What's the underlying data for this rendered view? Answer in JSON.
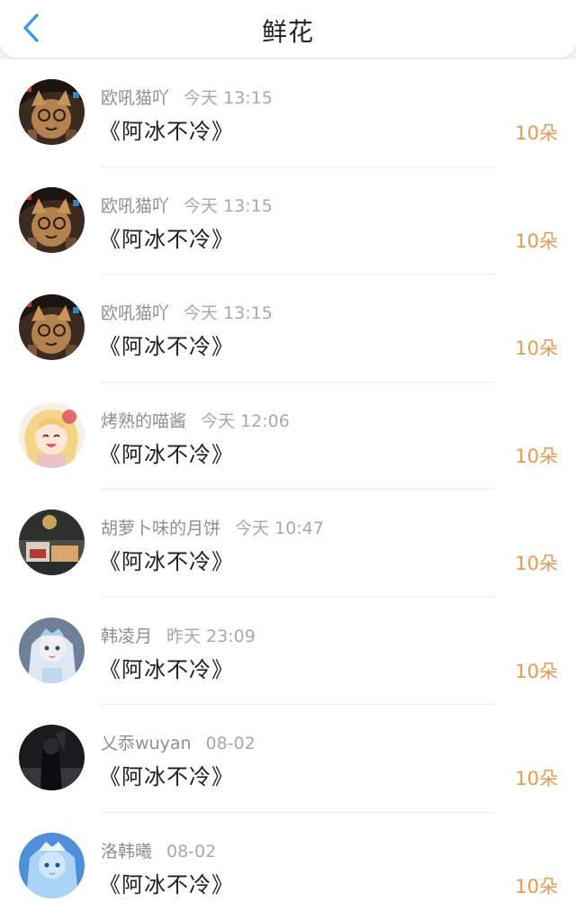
{
  "header": {
    "title": "鲜花"
  },
  "colors": {
    "accent": "#e59a4f",
    "back_icon": "#3b95e6"
  },
  "entries": [
    {
      "user": "欧吼猫吖",
      "time": "今天 13:15",
      "book": "《阿冰不冷》",
      "count": "10朵",
      "avatar": "cat-costume-avatar"
    },
    {
      "user": "欧吼猫吖",
      "time": "今天 13:15",
      "book": "《阿冰不冷》",
      "count": "10朵",
      "avatar": "cat-costume-avatar"
    },
    {
      "user": "欧吼猫吖",
      "time": "今天 13:15",
      "book": "《阿冰不冷》",
      "count": "10朵",
      "avatar": "cat-costume-avatar"
    },
    {
      "user": "烤熟的喵酱",
      "time": "今天 12:06",
      "book": "《阿冰不冷》",
      "count": "10朵",
      "avatar": "anime-girl-avatar"
    },
    {
      "user": "胡萝卜味的月饼",
      "time": "今天 10:47",
      "book": "《阿冰不冷》",
      "count": "10朵",
      "avatar": "room-photo-avatar"
    },
    {
      "user": "韩凌月",
      "time": "昨天 23:09",
      "book": "《阿冰不冷》",
      "count": "10朵",
      "avatar": "ice-princess-avatar"
    },
    {
      "user": "乂忝wuyan",
      "time": "08-02",
      "book": "《阿冰不冷》",
      "count": "10朵",
      "avatar": "dark-figure-avatar"
    },
    {
      "user": "洛韩曦",
      "time": "08-02",
      "book": "《阿冰不冷》",
      "count": "10朵",
      "avatar": "ice-princess-blue-avatar"
    }
  ]
}
